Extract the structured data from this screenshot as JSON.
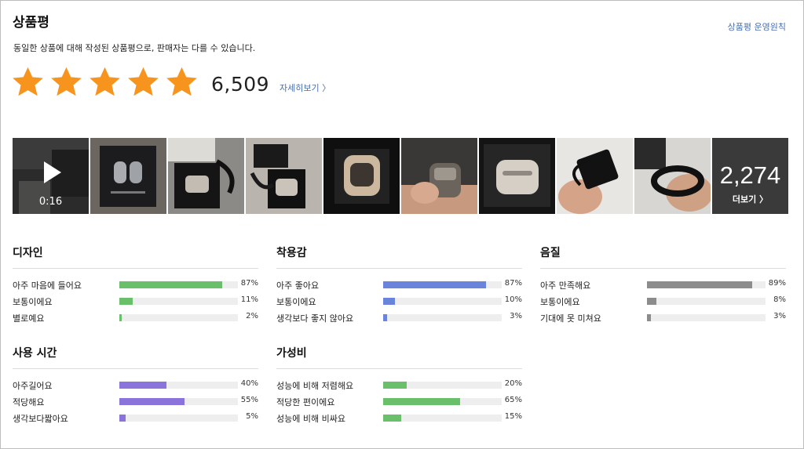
{
  "header": {
    "title": "상품평",
    "policy_link": "상품평 운영원칙",
    "description": "동일한 상품에 대해 작성된 상품평으로, 판매자는 다를 수 있습니다."
  },
  "rating": {
    "stars": 5,
    "max_stars": 5,
    "review_count": "6,509",
    "detail_link": "자세히보기 〉",
    "star_color": "#f7941d"
  },
  "gallery": {
    "video_duration": "0:16",
    "photos": [
      "video-thumbnail",
      "earbuds-box-photo",
      "opened-box-photo",
      "charging-case-photo",
      "open-case-photo",
      "case-in-hand-photo",
      "case-top-photo",
      "cable-photo",
      "cable-in-hand-photo"
    ],
    "more_count": "2,274",
    "more_label": "더보기 〉"
  },
  "categories": [
    {
      "title": "디자인",
      "color": "#6abf6a",
      "rows": [
        {
          "label": "아주 마음에 들어요",
          "value": 87,
          "pct": "87%"
        },
        {
          "label": "보통이에요",
          "value": 11,
          "pct": "11%"
        },
        {
          "label": "별로예요",
          "value": 2,
          "pct": "2%"
        }
      ]
    },
    {
      "title": "착용감",
      "color": "#6a84dc",
      "rows": [
        {
          "label": "아주 좋아요",
          "value": 87,
          "pct": "87%"
        },
        {
          "label": "보통이에요",
          "value": 10,
          "pct": "10%"
        },
        {
          "label": "생각보다 좋지 않아요",
          "value": 3,
          "pct": "3%"
        }
      ]
    },
    {
      "title": "음질",
      "color": "#8c8c8c",
      "rows": [
        {
          "label": "아주 만족해요",
          "value": 89,
          "pct": "89%"
        },
        {
          "label": "보통이에요",
          "value": 8,
          "pct": "8%"
        },
        {
          "label": "기대에 못 미쳐요",
          "value": 3,
          "pct": "3%"
        }
      ]
    },
    {
      "title": "사용 시간",
      "color": "#8a74dc",
      "rows": [
        {
          "label": "아주길어요",
          "value": 40,
          "pct": "40%"
        },
        {
          "label": "적당해요",
          "value": 55,
          "pct": "55%"
        },
        {
          "label": "생각보다짧아요",
          "value": 5,
          "pct": "5%"
        }
      ]
    },
    {
      "title": "가성비",
      "color": "#6abf6a",
      "rows": [
        {
          "label": "성능에 비해 저렴해요",
          "value": 20,
          "pct": "20%"
        },
        {
          "label": "적당한 편이에요",
          "value": 65,
          "pct": "65%"
        },
        {
          "label": "성능에 비해 비싸요",
          "value": 15,
          "pct": "15%"
        }
      ]
    }
  ]
}
